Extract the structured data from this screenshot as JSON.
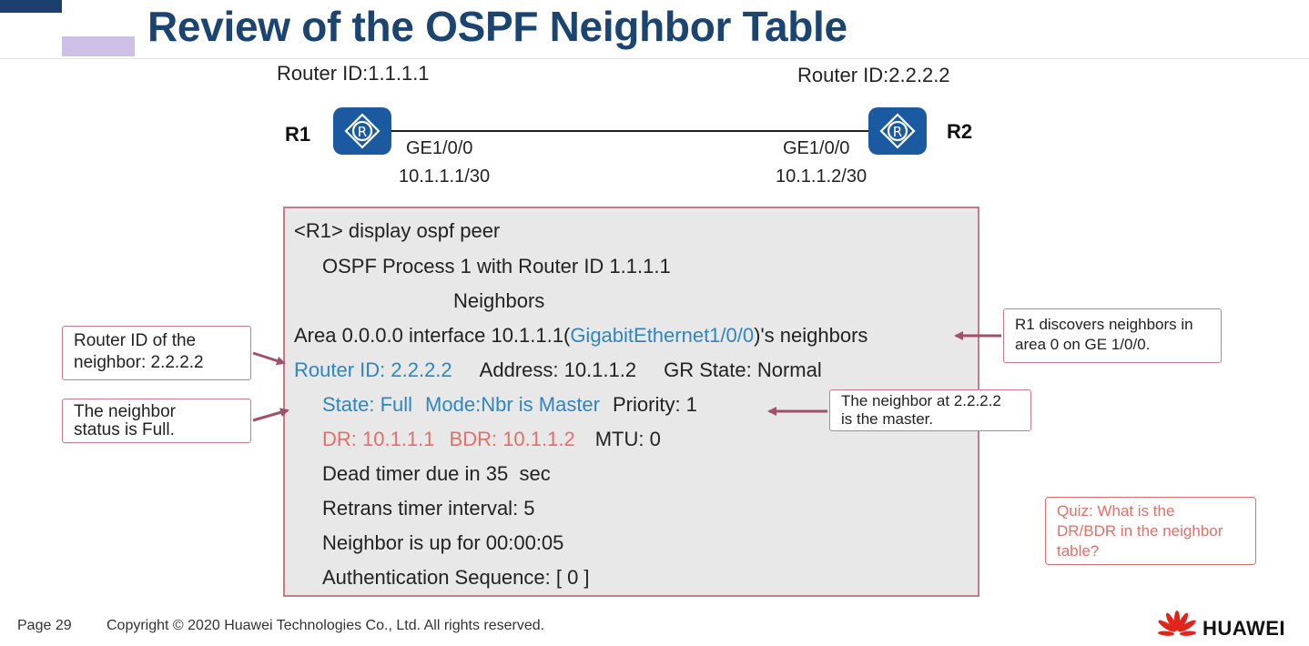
{
  "title": "Review of the OSPF Neighbor Table",
  "topology": {
    "r1": {
      "name": "R1",
      "router_id": "Router ID:1.1.1.1",
      "interface": "GE1/0/0",
      "ip": "10.1.1.1/30",
      "icon": "router-icon"
    },
    "r2": {
      "name": "R2",
      "router_id": "Router ID:2.2.2.2",
      "interface": "GE1/0/0",
      "ip": "10.1.1.2/30",
      "icon": "router-icon"
    }
  },
  "cli": {
    "command": "<R1> display ospf peer",
    "process": "OSPF Process 1 with Router ID 1.1.1.1",
    "neighbors_header": "Neighbors",
    "area_prefix": "Area 0.0.0.0 interface 10.1.1.1(",
    "area_interface": "GigabitEthernet1/0/0",
    "area_suffix": ")'s neighbors",
    "router_id": "Router ID: 2.2.2.2",
    "address": "Address: 10.1.1.2",
    "gr_state": "GR State: Normal",
    "state": "State: Full",
    "mode": "Mode:Nbr is Master",
    "priority": "Priority: 1",
    "dr": "DR: 10.1.1.1",
    "bdr": "BDR: 10.1.1.2",
    "mtu": "MTU: 0",
    "dead_timer": "Dead timer due in 35  sec",
    "retrans": "Retrans timer interval: 5",
    "uptime": "Neighbor is up for 00:00:05",
    "auth": "Authentication Sequence: [ 0 ]"
  },
  "callouts": {
    "neighbor_id": {
      "line1": "Router ID of the",
      "line2": "neighbor: 2.2.2.2"
    },
    "status": {
      "line1": "The neighbor",
      "line2": "status is Full."
    },
    "discovers": {
      "line1": "R1 discovers neighbors in",
      "line2": "area 0 on GE 1/0/0."
    },
    "master": {
      "line1": "The neighbor at 2.2.2.2",
      "line2": "is the master."
    },
    "quiz": {
      "line1": "Quiz: What is the",
      "line2": "DR/BDR in the neighbor",
      "line3": "table?"
    }
  },
  "footer": {
    "page": "Page 29",
    "copyright": "Copyright © 2020 Huawei Technologies Co., Ltd. All rights reserved.",
    "brand": "HUAWEI",
    "logo_icon": "huawei-logo-icon"
  },
  "colors": {
    "title": "#1b4470",
    "router_icon": "#1b5aa0",
    "highlight_blue": "#2e86c1",
    "highlight_red": "#e0706a",
    "callout_border": "#c97a8c",
    "cli_background": "#e8e8e8"
  }
}
